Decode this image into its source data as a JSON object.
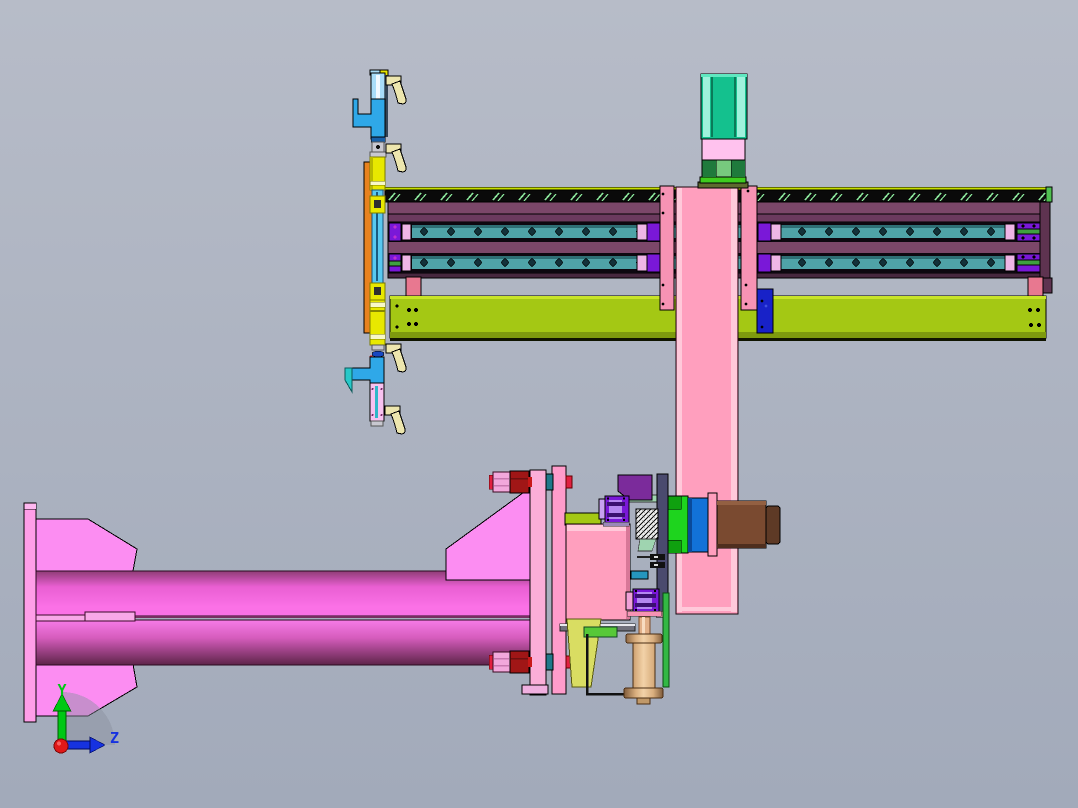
{
  "viewport": {
    "kind": "cad-3d-assembly-view",
    "axis_indicator": {
      "y_label": "Y",
      "z_label": "Z",
      "y_color": "#00C814",
      "z_color": "#1632E0",
      "origin_color": "#E01818"
    }
  },
  "colors": {
    "bg_top": "#B7BCC8",
    "bg_bottom": "#A2AABA",
    "rack_line": "#C8E000",
    "rack_bg": "#0A0A0A",
    "rack_hatch": "#8CE89C",
    "rack_cap": "#4FC050",
    "mauve": "#7B4769",
    "mauve_band": "#6B3A5E",
    "mauve_dark": "#47283F",
    "beam_end": "#5E3350",
    "rail_frame": "#0D0810",
    "rail_teal": "#4FA3A8",
    "rail_teal_dark": "#2E6E74",
    "rail_dot": "#13323A",
    "violet": "#7A18D8",
    "violet_light": "#B488F0",
    "violet_slot": "#3A1070",
    "violet_dot": "#C030D0",
    "end_pink": "#EFB6E6",
    "green_bar": "#3FA040",
    "chartreuse": "#A4C814",
    "chartreuse_hi": "#C8E428",
    "chartreuse_dark": "#7E9A0E",
    "salmon": "#E87890",
    "blue_plate": "#1822C8",
    "col_pink": "#FF9FBE",
    "col_pink_light": "#FFC9DA",
    "side_pink": "#F793B4",
    "teal_block": "#14C18E",
    "teal_light": "#9FF2DC",
    "teal_edge": "#0A7A58",
    "teal_top": "#5FE8C0",
    "pink_plate2": "#FFC2EE",
    "grn_brk_dark": "#1F7A3C",
    "grn_brk_light": "#77C97E",
    "grn_strip": "#3FCC1F",
    "olive": "#5E6A2E",
    "carr_pink_dark": "#D87898",
    "purple_poly": "#7B2B9B",
    "mint": "#9FD4B0",
    "slate": "#4A4A6E",
    "green_block": "#1ED41E",
    "green_block_dark": "#0FA00F",
    "blue_block": "#1272D8",
    "blue_block_dark": "#0A4A9A",
    "motor": "#7A4A30",
    "motor_hi": "#936042",
    "motor_dark": "#4E2E1E",
    "motor_cap": "#5E3A26",
    "cyanbar": "#2596BE",
    "graybar": "#70707C",
    "graybar_hi": "#E8E8EE",
    "khaki": "#D9DD62",
    "khaki_edge": "#5A5A10",
    "green_bar2": "#57C838",
    "green_rod": "#33B844",
    "copper_dark": "#7E5A3A",
    "copper_mid": "#D9AE7E",
    "copper_light": "#F2D2A8",
    "copper_rod": "#E2B088",
    "copper_rod_hi": "#F8DCC0",
    "copper_edge": "#4A2E14",
    "copper_tab": "#C09868",
    "gusset": "#FC8DF2",
    "backplate": "#FF9EE8",
    "backplate_hi": "#FFB8F0",
    "cyl_u0": "#8F3C76",
    "cyl_u1": "#E95FD2",
    "cyl_u2": "#FB71E6",
    "cyl_l0": "#F77BE8",
    "cyl_l1": "#D55CBC",
    "cyl_l2": "#5E2449",
    "cyl_seam": "#F8A8E8",
    "cyl_stroke": "#2A0A20",
    "seam_line": "#7A2E62",
    "plate1": "#FBAED8",
    "plate2": "#FF9CCB",
    "plate_foot": "#F0B0E0",
    "bolt_red": "#C81818",
    "bolt_darkred": "#A01616",
    "bolt_pink": "#F2A8DC",
    "bolt_crimson": "#E02040",
    "bolt_teal": "#20788A",
    "orange": "#E8821E",
    "cyanrail_top": "#A8DCF8",
    "cyanrail_white": "#F0F8FF",
    "bracket_blue": "#2FA8E8",
    "bracket_dark": "#1860A8",
    "hook_teal": "#28C8C8",
    "lin_rail": "#58C8F0",
    "lin_rail_dark": "#1A5A80",
    "yellow": "#E8E800",
    "yellow_dark": "#B8B800",
    "yellow_pale": "#F8F8C8",
    "yellow_edge": "#7A7A00",
    "metal": "#C8C8D0",
    "metal_dark": "#555555",
    "blue_oval": "#1848C0",
    "torch_pink": "#F8C2F0",
    "torch_dot": "#7A2A6A",
    "cream": "#EDE6AE",
    "axis_green": "#00C814",
    "axis_blue": "#1632E0",
    "axis_red": "#E01818",
    "axis_shadow": "#8A90A0",
    "knurl_bg": "#F0F0F0"
  }
}
